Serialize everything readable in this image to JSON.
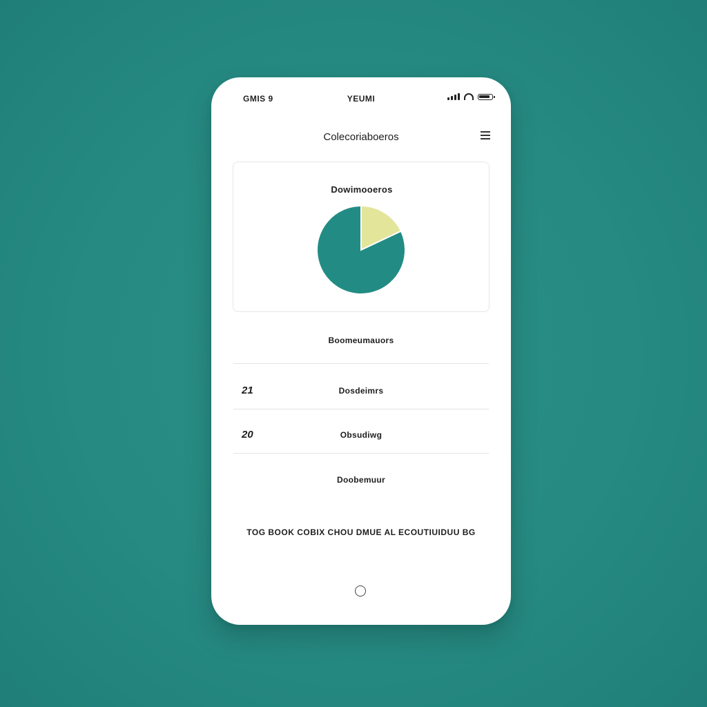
{
  "status_bar": {
    "time": "GMIS 9",
    "carrier": "YEUMI"
  },
  "header": {
    "title": "Colecoriaboeros"
  },
  "chart_card": {
    "title": "Dowimooeros"
  },
  "chart_data": {
    "type": "pie",
    "title": "Dowimooeros",
    "values": [
      18,
      82
    ],
    "colors": [
      "#e3e59b",
      "#228c84"
    ],
    "start_angle_deg": 0
  },
  "section": {
    "label": "Boomeumauors"
  },
  "rows": [
    {
      "value": "21",
      "label": "Dosdeimrs"
    },
    {
      "value": "20",
      "label": "Obsudiwg"
    }
  ],
  "footer": {
    "label": "Doobemuur",
    "note": "TOG BOOK COBIX CHOU DMUE AL ECOUTIUIDUU BG"
  },
  "colors": {
    "background": "#268a82",
    "pie_main": "#228c84",
    "pie_slice": "#e3e59b"
  }
}
